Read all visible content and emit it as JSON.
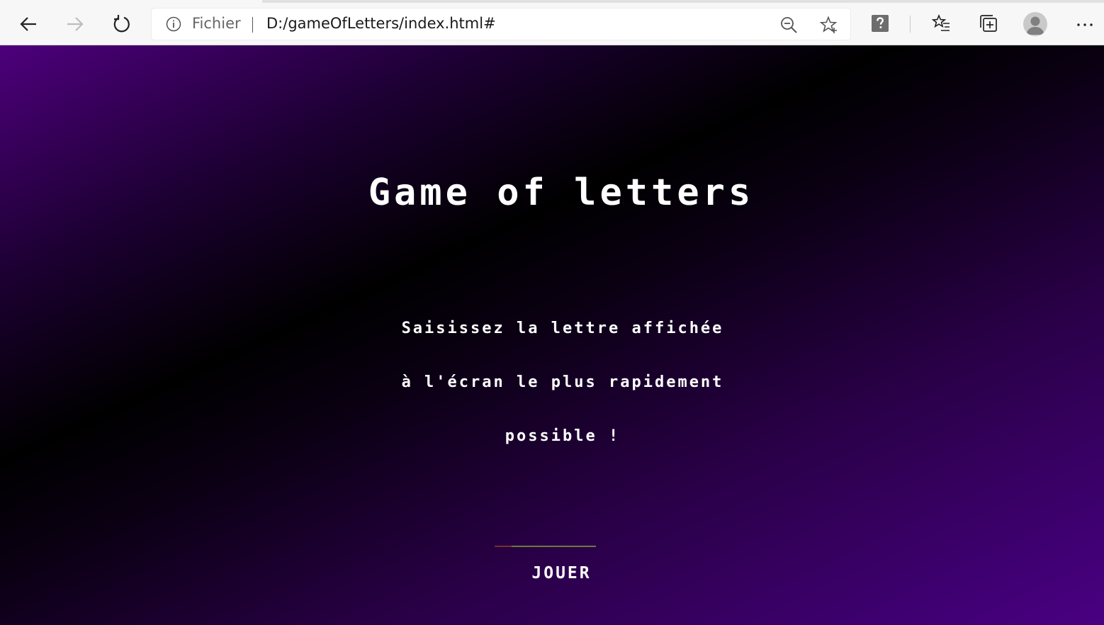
{
  "browser": {
    "scheme_label": "Fichier",
    "url": "D:/gameOfLetters/index.html#",
    "icons": {
      "back": "back-arrow-icon",
      "forward": "forward-arrow-icon",
      "refresh": "refresh-icon",
      "info": "info-icon",
      "zoom": "zoom-icon",
      "favorite": "star-icon",
      "extension": "help-extension-icon",
      "favorites": "favorites-list-icon",
      "collections": "collections-icon",
      "profile": "avatar",
      "menu": "more-menu-icon"
    }
  },
  "page": {
    "title": "Game of letters",
    "instructions": [
      "Saisissez la lettre affichée",
      "à l'écran le plus rapidement",
      "possible !"
    ],
    "play_button": "JOUER",
    "colors": {
      "gradient_dark": "#000000",
      "gradient_purple": "#4d007c",
      "text": "#ffffff"
    }
  }
}
